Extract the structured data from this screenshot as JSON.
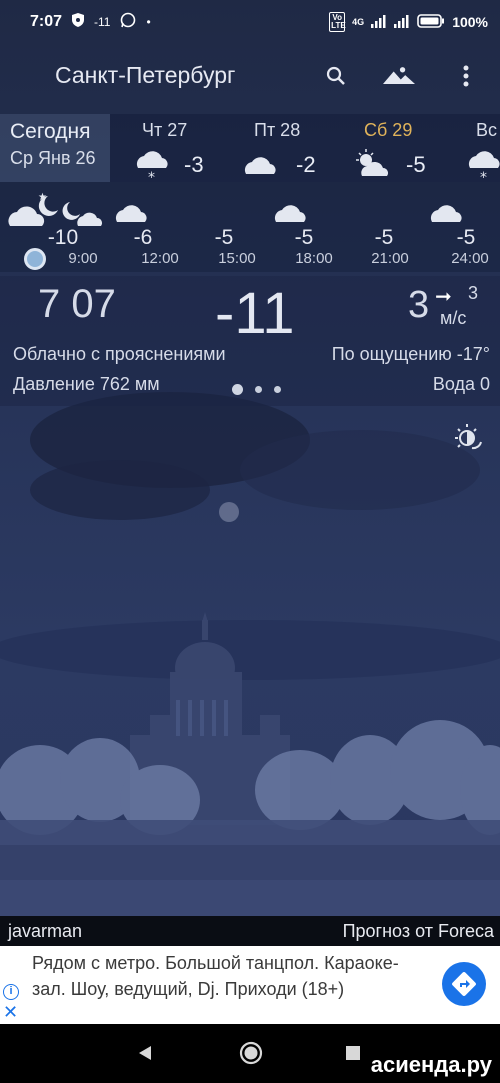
{
  "status_bar": {
    "time": "7:07",
    "temp_indicator": "-11",
    "dot": "•",
    "volte": "Vo LTE",
    "network": "4G",
    "battery": "100%"
  },
  "header": {
    "city": "Санкт-Петербург",
    "icons": [
      "search-icon",
      "landscape-icon",
      "more-vert-icon"
    ]
  },
  "days": {
    "today_label": "Сегодня",
    "today_date": "Ср Янв 26",
    "items": [
      {
        "name": "Чт 27",
        "temp": "-3",
        "icon": "cloud-snow-icon"
      },
      {
        "name": "Пт 28",
        "temp": "-2",
        "icon": "cloud-icon"
      },
      {
        "name": "Сб 29",
        "temp": "-5",
        "icon": "sun-cloud-icon",
        "weekend": true
      },
      {
        "name": "Вс",
        "temp": "",
        "icon": "cloud-snow-icon"
      }
    ]
  },
  "hourly": [
    {
      "time": "9:00",
      "temp": "-10"
    },
    {
      "time": "12:00",
      "temp": "-6"
    },
    {
      "time": "15:00",
      "temp": "-5"
    },
    {
      "time": "18:00",
      "temp": "-5"
    },
    {
      "time": "21:00",
      "temp": "-5"
    },
    {
      "time": "24:00",
      "temp": "-5"
    }
  ],
  "current": {
    "time": "7 07",
    "temp": "-11",
    "wind": "3",
    "wind_arrow": "➞",
    "wind_speed": "3",
    "wind_unit": "м/с",
    "description": "Облачно с прояснениями",
    "feels_like": "По ощущению -17°",
    "pressure": "Давление 762 мм",
    "water": "Вода 0"
  },
  "credits": {
    "author": "javarman",
    "provider": "Прогноз от Foreca"
  },
  "ad": {
    "text": "Рядом с метро. Большой танцпол. Караоке-зал. Шоу, ведущий, Dj. Приходи (18+)",
    "info": "i",
    "close": "✕"
  },
  "watermark": "асиенда.ру"
}
